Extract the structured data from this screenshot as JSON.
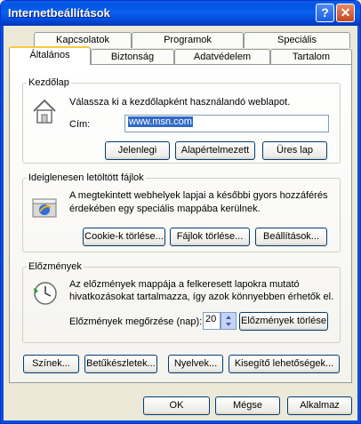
{
  "window": {
    "title": "Internetbeállítások",
    "help_glyph": "?",
    "close_glyph": "✕"
  },
  "tabs": {
    "row1": [
      "Kapcsolatok",
      "Programok",
      "Speciális"
    ],
    "row2": [
      "Általános",
      "Biztonság",
      "Adatvédelem",
      "Tartalom"
    ]
  },
  "home": {
    "legend": "Kezdőlap",
    "description": "Válassza ki a kezdőlapként használandó weblapot.",
    "address_label": "Cím:",
    "address_value": "www.msn.com",
    "buttons": [
      "Jelenlegi",
      "Alapértelmezett",
      "Üres lap"
    ]
  },
  "temp": {
    "legend": "Ideiglenesen letöltött fájlok",
    "line1": "A megtekintett webhelyek lapjai a későbbi gyors hozzáférés",
    "line2": "érdekében egy speciális mappába kerülnek.",
    "buttons": [
      "Cookie-k törlése...",
      "Fájlok törlése...",
      "Beállítások..."
    ]
  },
  "history": {
    "legend": "Előzmények",
    "line1": "Az előzmények mappája a felkeresett lapokra mutató",
    "line2": "hivatkozásokat tartalmazza, így azok könnyebben érhetők el.",
    "keep_label": "Előzmények megőrzése (nap):",
    "keep_value": "20",
    "clear_button": "Előzmények törlése"
  },
  "bottom_buttons": [
    "Színek...",
    "Betűkészletek...",
    "Nyelvek...",
    "Kisegítő lehetőségek..."
  ],
  "dialog_buttons": {
    "ok": "OK",
    "cancel": "Mégse",
    "apply": "Alkalmaz"
  }
}
